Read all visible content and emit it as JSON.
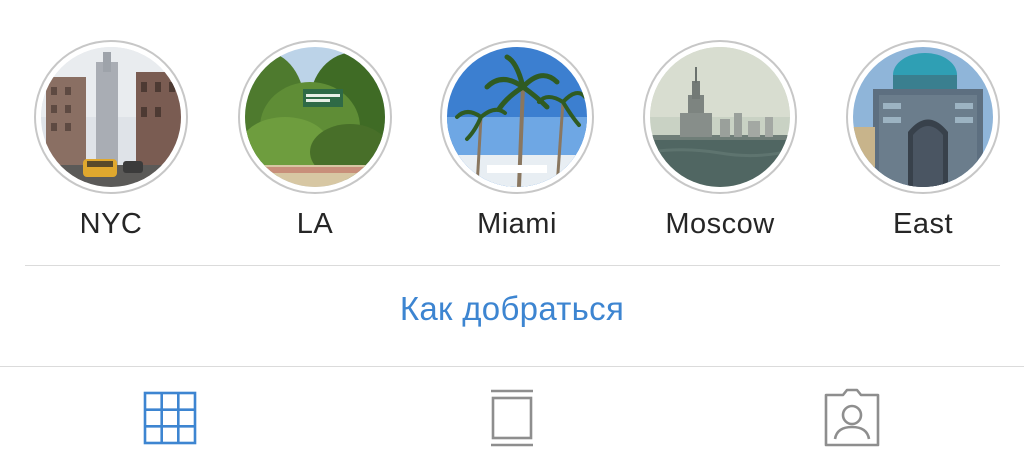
{
  "highlights": [
    {
      "label": "NYC",
      "icon": "nyc-cover-image"
    },
    {
      "label": "LA",
      "icon": "la-cover-image"
    },
    {
      "label": "Miami",
      "icon": "miami-cover-image"
    },
    {
      "label": "Moscow",
      "icon": "moscow-cover-image"
    },
    {
      "label": "East",
      "icon": "east-cover-image"
    }
  ],
  "directions_link": "Как добраться",
  "tabs": [
    {
      "icon": "grid-icon",
      "active": true
    },
    {
      "icon": "feed-icon",
      "active": false
    },
    {
      "icon": "tagged-icon",
      "active": false
    }
  ],
  "colors": {
    "link": "#3d85d1",
    "active_tab": "#3d85d1",
    "inactive_tab": "#8e8e8e",
    "ring": "#c7c7c7",
    "divider": "#dbdbdb",
    "text": "#262626"
  }
}
